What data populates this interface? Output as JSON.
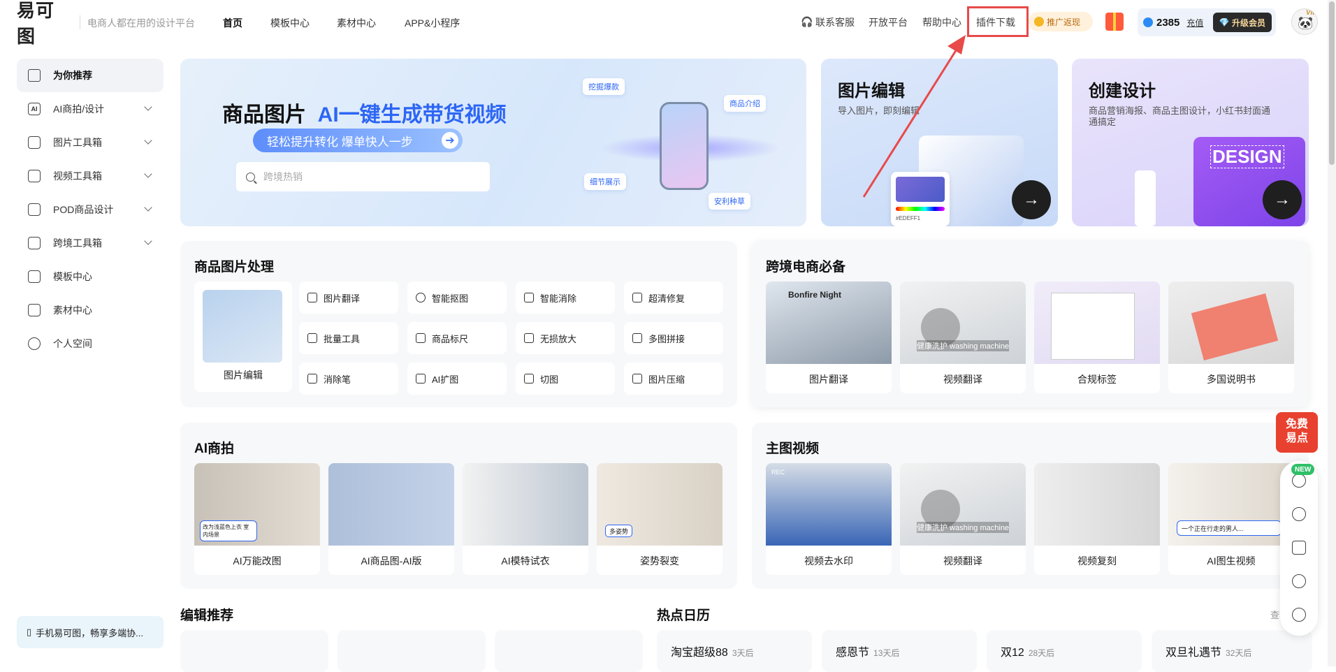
{
  "brand": {
    "logo_text": "易可图",
    "slogan": "电商人都在用的设计平台"
  },
  "nav": {
    "items": [
      "首页",
      "模板中心",
      "素材中心",
      "APP&小程序"
    ]
  },
  "header_right": {
    "customer_service": "联系客服",
    "open_platform": "开放平台",
    "help_center": "帮助中心",
    "plugin_download": "插件下载",
    "promo_rebate": "推广返现",
    "points": "2385",
    "recharge": "充值",
    "upgrade_vip": "升级会员",
    "vip_tag": "VIP"
  },
  "sidebar": {
    "items": [
      {
        "label": "为你推荐",
        "icon": "home-icon",
        "icon_text": "",
        "expandable": false
      },
      {
        "label": "AI商拍/设计",
        "icon": "ai-icon",
        "icon_text": "AI",
        "expandable": true
      },
      {
        "label": "图片工具箱",
        "icon": "image-toolbox-icon",
        "icon_text": "",
        "expandable": true
      },
      {
        "label": "视频工具箱",
        "icon": "video-toolbox-icon",
        "icon_text": "",
        "expandable": true
      },
      {
        "label": "POD商品设计",
        "icon": "pod-icon",
        "icon_text": "",
        "expandable": true
      },
      {
        "label": "跨境工具箱",
        "icon": "crossborder-icon",
        "icon_text": "",
        "expandable": true
      },
      {
        "label": "模板中心",
        "icon": "template-icon",
        "icon_text": "",
        "expandable": false
      },
      {
        "label": "素材中心",
        "icon": "material-icon",
        "icon_text": "",
        "expandable": false
      },
      {
        "label": "个人空间",
        "icon": "user-icon",
        "icon_text": "",
        "expandable": false
      }
    ],
    "mobile_tip": "手机易可图，畅享多端协..."
  },
  "banner": {
    "title_a": "商品图片",
    "title_b": "AI一键生成带货视频",
    "pill": "轻松提升转化 爆单快人一步",
    "search_placeholder": "跨境热销",
    "tags": [
      "挖掘爆款",
      "商品介绍",
      "细节展示",
      "安利种草"
    ]
  },
  "cards": {
    "edit": {
      "title": "图片编辑",
      "subtitle": "导入图片，即刻编辑",
      "hex": "#EDEFF1"
    },
    "create": {
      "title": "创建设计",
      "subtitle": "商品营销海报、商品主图设计，小红书封面通通搞定",
      "design_word": "DESIGN"
    }
  },
  "product_image": {
    "title": "商品图片处理",
    "main_label": "图片编辑",
    "tools": [
      "图片翻译",
      "智能抠图",
      "智能消除",
      "超清修复",
      "批量工具",
      "商品标尺",
      "无损放大",
      "多图拼接",
      "消除笔",
      "AI扩图",
      "切图",
      "图片压缩"
    ]
  },
  "crossborder": {
    "title": "跨境电商必备",
    "items": [
      "图片翻译",
      "视频翻译",
      "合规标签",
      "多国说明书"
    ],
    "overlay_bonfire": "Bonfire Night",
    "overlay_washer": "健康洗护 washing machine"
  },
  "ai_shoot": {
    "title": "AI商拍",
    "items": [
      "AI万能改图",
      "AI商品图-AI版",
      "AI模特试衣",
      "姿势裂变"
    ],
    "bubble_1": "改为浅蓝色上衣 室内场景",
    "bubble_2": "多姿势"
  },
  "main_video": {
    "title": "主图视频",
    "items": [
      "视频去水印",
      "视频翻译",
      "视频复刻",
      "AI图生视频"
    ],
    "rec_label": "REC",
    "ai_video_prompt": "一个正在行走的男人..."
  },
  "bottom": {
    "editor_pick": "编辑推荐",
    "hot_calendar": "热点日历",
    "more": "查看",
    "calendar": [
      {
        "name": "淘宝超级88",
        "days": "3天后"
      },
      {
        "name": "感恩节",
        "days": "13天后"
      },
      {
        "name": "双12",
        "days": "28天后"
      },
      {
        "name": "双旦礼遇节",
        "days": "32天后"
      }
    ]
  },
  "float": {
    "new_badge": "NEW",
    "free_line1": "免费",
    "free_line2": "易点"
  },
  "colors": {
    "accent": "#2d66f5",
    "highlight_box": "#e84a4a",
    "vip_gold": "#f7d79c"
  }
}
